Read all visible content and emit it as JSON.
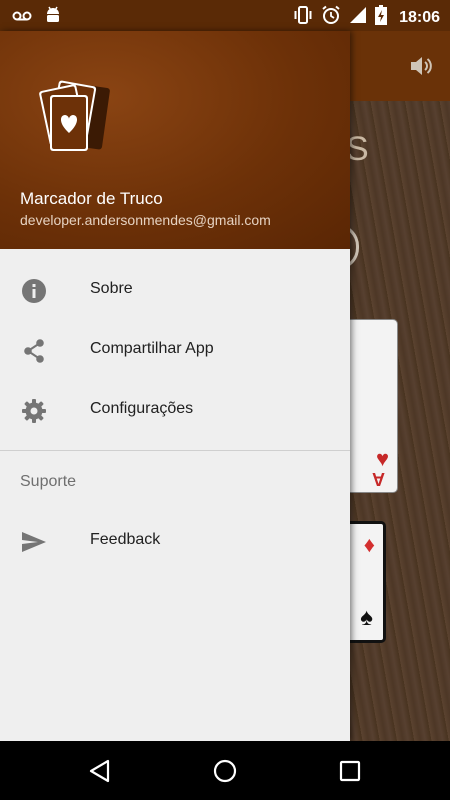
{
  "status_bar": {
    "time": "18:06",
    "icons": [
      "voicemail-icon",
      "android-icon",
      "vibrate-icon",
      "alarm-icon",
      "signal-icon",
      "battery-icon"
    ]
  },
  "app": {
    "title_fragment": "S",
    "card_rank": "A"
  },
  "drawer": {
    "header": {
      "app_name": "Marcador de Truco",
      "email": "developer.andersonmendes@gmail.com"
    },
    "items": [
      {
        "label": "Sobre",
        "icon": "info-icon"
      },
      {
        "label": "Compartilhar App",
        "icon": "share-icon"
      },
      {
        "label": "Configurações",
        "icon": "gear-icon"
      }
    ],
    "section_title": "Suporte",
    "support_items": [
      {
        "label": "Feedback",
        "icon": "send-icon"
      }
    ]
  },
  "colors": {
    "header": "#6d3108",
    "status_bar": "#5a2a06",
    "drawer_bg": "#efefef",
    "icon": "#757575"
  }
}
